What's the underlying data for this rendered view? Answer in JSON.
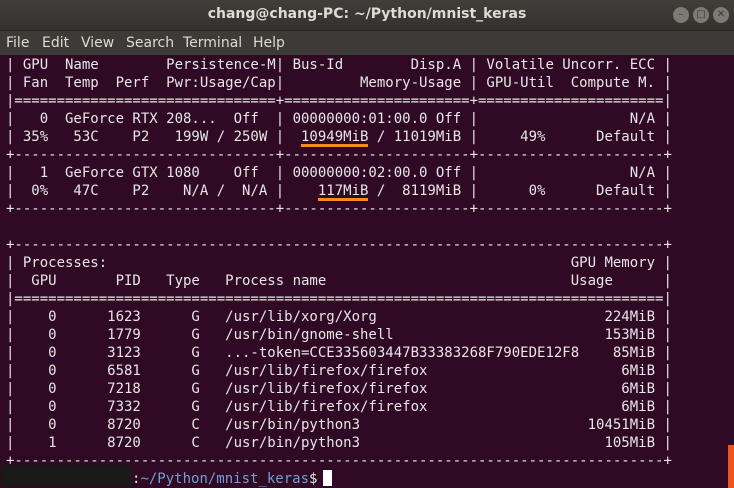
{
  "window": {
    "title": "chang@chang-PC: ~/Python/mnist_keras"
  },
  "menu": [
    "File",
    "Edit",
    "View",
    "Search",
    "Terminal",
    "Help"
  ],
  "lines": [
    "| GPU  Name        Persistence-M| Bus-Id        Disp.A | Volatile Uncorr. ECC |",
    "| Fan  Temp  Perf  Pwr:Usage/Cap|         Memory-Usage | GPU-Util  Compute M. |",
    "|===============================+======================+======================|",
    "|   0  GeForce RTX 208...  Off  | 00000000:01:00.0 Off |                  N/A |",
    "| 35%   53C    P2   199W / 250W |  10949MiB / 11019MiB |     49%      Default |",
    "+-------------------------------+----------------------+----------------------+",
    "|   1  GeForce GTX 1080    Off  | 00000000:02:00.0 Off |                  N/A |",
    "|  0%   47C    P2    N/A /  N/A |    117MiB /  8119MiB |      0%      Default |",
    "+-------------------------------+----------------------+----------------------+",
    "",
    "+-----------------------------------------------------------------------------+",
    "| Processes:                                                       GPU Memory |",
    "|  GPU       PID   Type   Process name                             Usage      |",
    "|=============================================================================|",
    "|    0      1623      G   /usr/lib/xorg/Xorg                           224MiB |",
    "|    0      1779      G   /usr/bin/gnome-shell                         153MiB |",
    "|    0      3123      G   ...-token=CCE335603447B33383268F790EDE12F8    85MiB |",
    "|    0      6581      G   /usr/lib/firefox/firefox                       6MiB |",
    "|    0      7218      G   /usr/lib/firefox/firefox                       6MiB |",
    "|    0      7332      G   /usr/lib/firefox/firefox                       6MiB |",
    "|    0      8720      C   /usr/bin/python3                           10451MiB |",
    "|    1      8720      C   /usr/bin/python3                             105MiB |",
    "+-----------------------------------------------------------------------------+"
  ],
  "prompt": {
    "sep": ":",
    "path": "~/Python/mnist_keras",
    "symbol": "$"
  },
  "colors": {
    "background": "#300a24",
    "text": "#e6e6e6",
    "highlight": "#f28c1b",
    "prompt_path": "#729fcf"
  }
}
